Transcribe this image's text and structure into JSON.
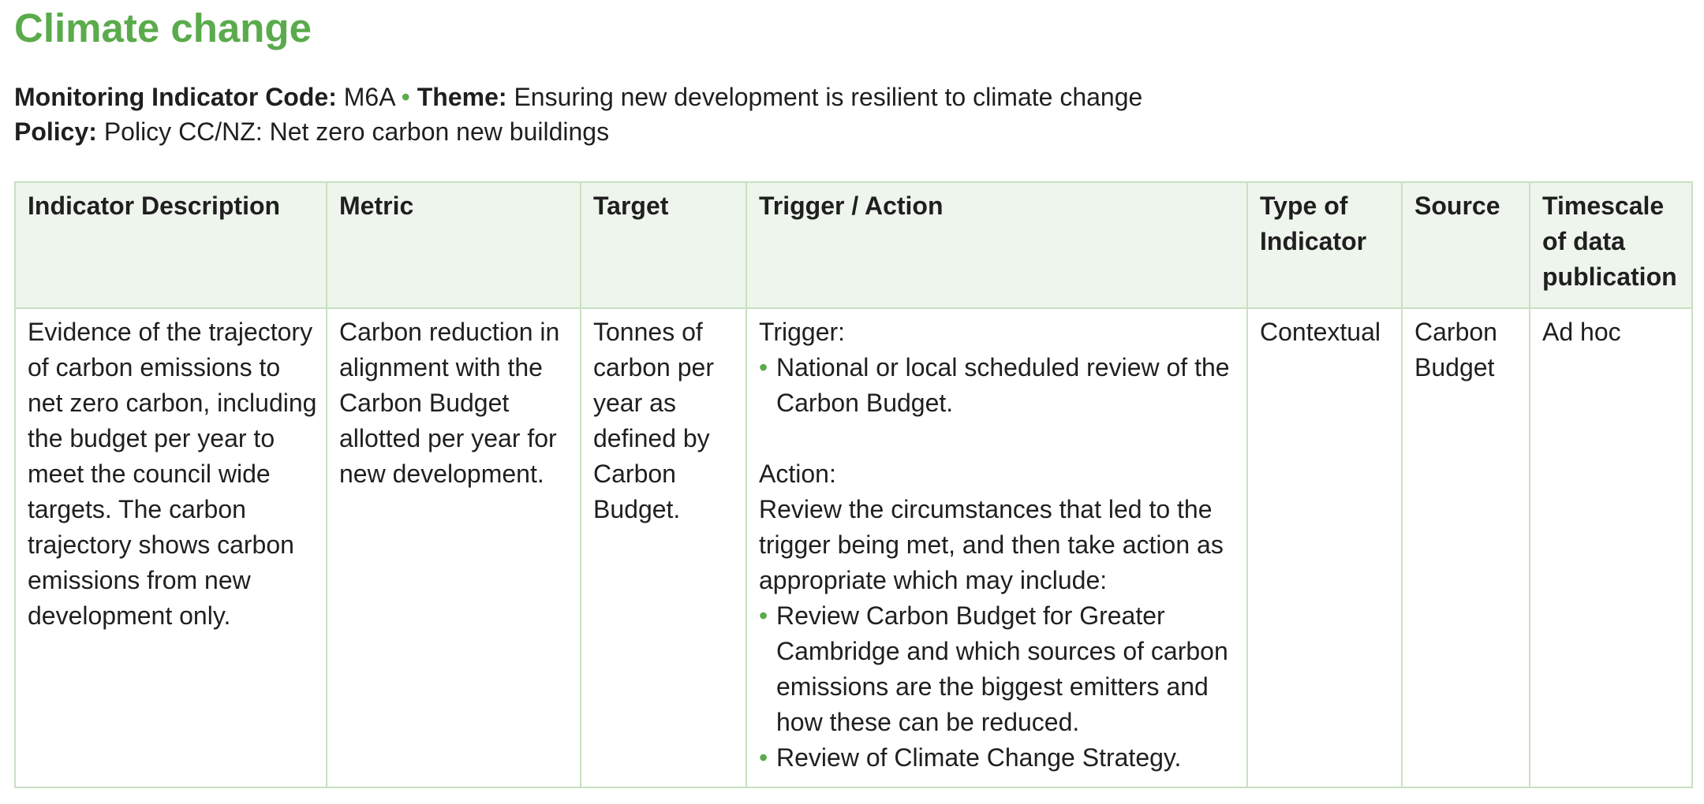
{
  "title": "Climate change",
  "meta": {
    "code_label": "Monitoring Indicator Code:",
    "code_value": "M6A",
    "separator": "•",
    "theme_label": "Theme:",
    "theme_value": "Ensuring new development is resilient to climate change",
    "policy_label": "Policy:",
    "policy_value": "Policy CC/NZ: Net zero carbon new buildings"
  },
  "table": {
    "headers": [
      "Indicator Description",
      "Metric",
      "Target",
      "Trigger / Action",
      "Type of Indicator",
      "Source",
      "Timescale of data publication"
    ],
    "row": {
      "description": "Evidence of the trajectory of carbon emissions to net zero carbon, including the budget per year to meet the council wide targets. The carbon trajectory shows carbon emissions from new development only.",
      "metric": "Carbon reduction in alignment with the Carbon Budget allotted per year for new development.",
      "target": "Tonnes of carbon per year as defined by Carbon Budget.",
      "trigger_label": "Trigger:",
      "trigger_items": [
        "National or local scheduled review of the Carbon Budget."
      ],
      "action_label": "Action:",
      "action_text": "Review the circumstances that led to the trigger being met, and then take action as appropriate which may include:",
      "action_items": [
        "Review Carbon Budget for Greater Cambridge and which sources of carbon emissions are the biggest emitters and how these can be reduced.",
        "Review of Climate Change Strategy."
      ],
      "type": "Contextual",
      "source": "Carbon Budget",
      "timescale": "Ad hoc"
    }
  },
  "colors": {
    "accent": "#5aab4b",
    "header_bg": "#eef5ec",
    "border": "#c8e1c2"
  }
}
